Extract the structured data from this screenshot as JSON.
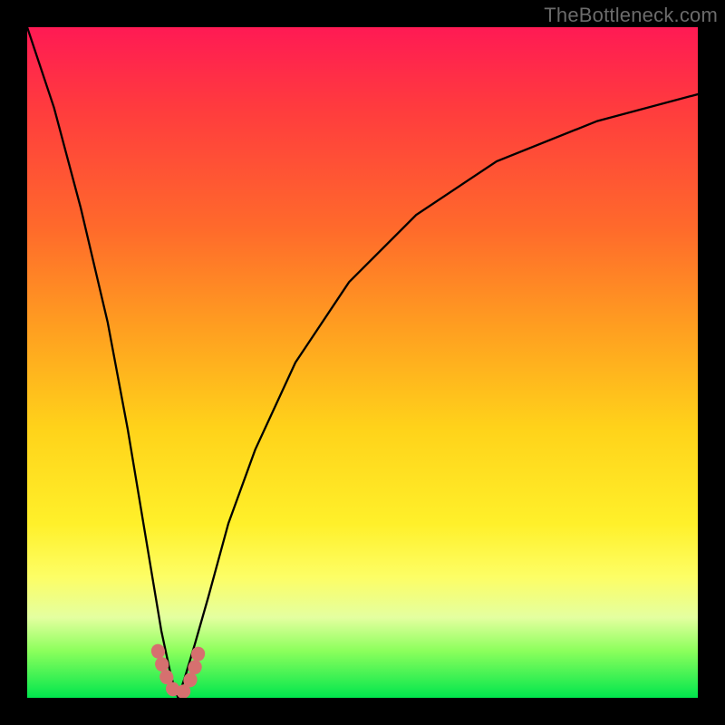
{
  "watermark": "TheBottleneck.com",
  "gradient_colors": {
    "top": "#ff1a54",
    "mid_high": "#ff9f20",
    "mid": "#fff02a",
    "mid_low": "#e4ffa0",
    "bottom": "#00e64d"
  },
  "chart_data": {
    "type": "line",
    "title": "",
    "xlabel": "",
    "ylabel": "",
    "xlim": [
      0,
      100
    ],
    "ylim": [
      0,
      100
    ],
    "grid": false,
    "legend": false,
    "note": "Bottleneck-style V-curve; minimum at x≈22.5. Values estimated from pixel position; no axes or tick labels are rendered in the image.",
    "series": [
      {
        "name": "bottleneck-curve",
        "x": [
          0,
          4,
          8,
          12,
          15,
          18,
          20,
          21.5,
          22.5,
          23.5,
          25,
          27,
          30,
          34,
          40,
          48,
          58,
          70,
          85,
          100
        ],
        "y": [
          100,
          88,
          73,
          56,
          40,
          22,
          10,
          3,
          0,
          3,
          8,
          15,
          26,
          37,
          50,
          62,
          72,
          80,
          86,
          90
        ]
      }
    ],
    "markers": {
      "style": "thick-rounded-segment",
      "color": "#d6706f",
      "points_x": [
        19.5,
        20.3,
        21.1,
        21.9,
        22.7,
        23.5,
        24.3,
        25.1,
        25.7
      ],
      "points_y": [
        7,
        4.3,
        2.3,
        1.0,
        0.5,
        1.1,
        2.6,
        4.8,
        7.5
      ]
    }
  }
}
